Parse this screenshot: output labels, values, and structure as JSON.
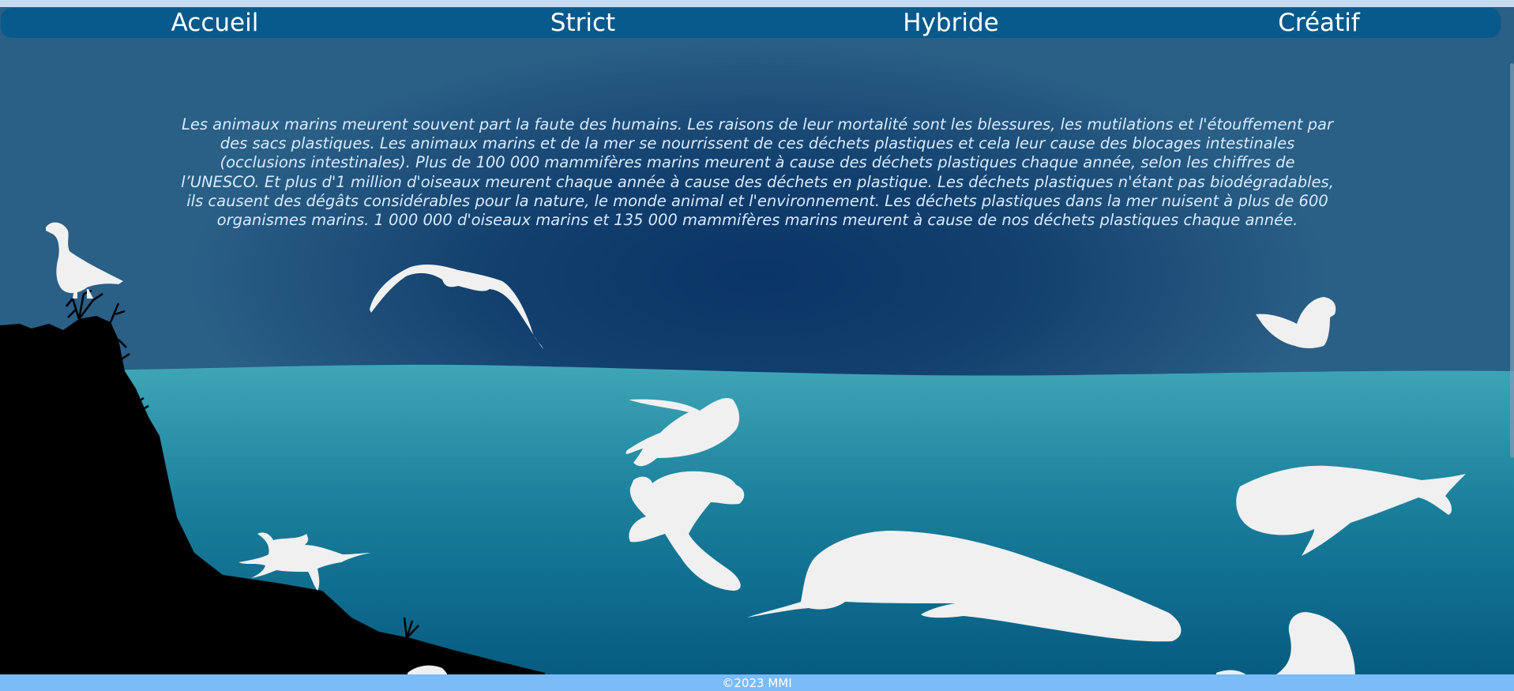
{
  "nav": {
    "items": [
      {
        "label": "Accueil"
      },
      {
        "label": "Strict"
      },
      {
        "label": "Hybride"
      },
      {
        "label": "Créatif"
      }
    ]
  },
  "intro": {
    "text": "Les animaux marins meurent souvent part la faute des humains. Les raisons de leur mortalité sont les blessures, les mutilations et l'étouffement par des sacs plastiques. Les animaux marins et de la mer se nourrissent de ces déchets plastiques et cela leur cause des blocages intestinales (occlusions intestinales). Plus de 100 000 mammifères marins meurent à cause des déchets plastiques chaque année, selon les chiffres de l’UNESCO. Et plus d'1 million d'oiseaux meurent chaque année à cause des déchets en plastique. Les déchets plastiques n'étant pas biodégradables, ils causent des dégâts considérables pour la nature, le monde animal et l'environnement. Les déchets plastiques dans la mer nuisent à plus de 600 organismes marins. 1 000 000 d'oiseaux marins et 135 000 mammifères marins meurent à cause de nos déchets plastiques chaque année."
  },
  "footer": {
    "text": "©2023 MMI"
  },
  "colors": {
    "nav_bg": "#075a8b",
    "sky_center": "#0a3567",
    "sea_top": "#3fa6b7",
    "sea_bottom": "#055a80",
    "footer_bg": "#7bbcf8",
    "silhouette": "#f0f0f0"
  }
}
